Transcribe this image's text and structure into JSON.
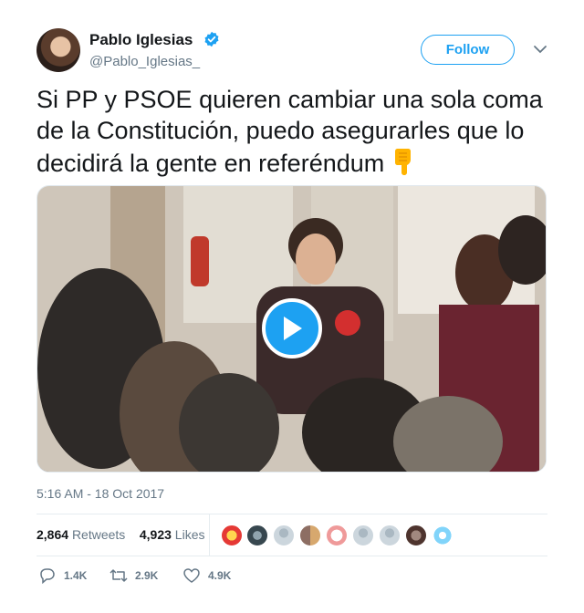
{
  "author": {
    "name": "Pablo Iglesias",
    "handle": "@Pablo_Iglesias_",
    "verified": true
  },
  "follow_label": "Follow",
  "tweet": {
    "text": "Si PP y PSOE quieren cambiar una sola coma de la Constitución, puedo asegurarles que lo decidirá la gente en referéndum",
    "emoji": "pointing-down-hand"
  },
  "media": {
    "type": "video",
    "play_icon": "play-icon"
  },
  "timestamp": "5:16 AM - 18 Oct 2017",
  "stats": {
    "retweets_count": "2,864",
    "retweets_label": "Retweets",
    "likes_count": "4,923",
    "likes_label": "Likes"
  },
  "liker_avatar_count": 9,
  "actions": {
    "reply_count": "1.4K",
    "retweet_count": "2.9K",
    "like_count": "4.9K"
  },
  "colors": {
    "accent": "#1da1f2",
    "muted": "#657786",
    "text": "#14171a",
    "border": "#e6ecf0"
  }
}
